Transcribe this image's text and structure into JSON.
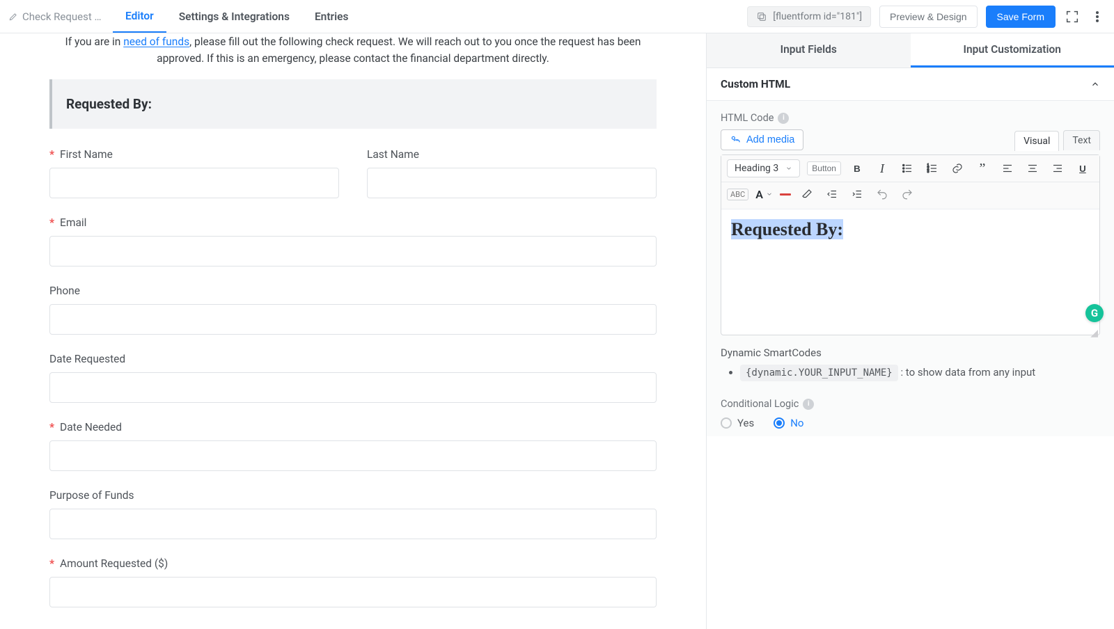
{
  "topbar": {
    "doc_title": "Check Request F...",
    "tabs": [
      {
        "label": "Editor",
        "active": true
      },
      {
        "label": "Settings & Integrations",
        "active": false
      },
      {
        "label": "Entries",
        "active": false
      }
    ],
    "shortcode": "[fluentform id=\"181\"]",
    "preview": "Preview & Design",
    "save": "Save Form"
  },
  "form": {
    "intro_prefix": "If you are in ",
    "intro_link": "need of funds",
    "intro_rest": ", please fill out the following check request. We will reach out to you once the request has been approved. If this is an emergency, please contact the financial department directly.",
    "section_title": "Requested By:",
    "fields": {
      "first_name": "First Name",
      "last_name": "Last Name",
      "email": "Email",
      "phone": "Phone",
      "date_requested": "Date Requested",
      "date_needed": "Date Needed",
      "purpose": "Purpose of Funds",
      "amount": "Amount Requested ($)"
    }
  },
  "inspector": {
    "tabs": {
      "input_fields": "Input Fields",
      "input_custom": "Input Customization"
    },
    "panel_title": "Custom HTML",
    "html_code_label": "HTML Code",
    "add_media": "Add media",
    "mode_visual": "Visual",
    "mode_text": "Text",
    "format_dd": "Heading 3",
    "tag_btn": "Button",
    "rte_sel_text": "Requested By:",
    "smartcodes_label": "Dynamic SmartCodes",
    "smartcode_chip": "{dynamic.YOUR_INPUT_NAME}",
    "smartcode_desc": ": to show data from any input",
    "cond_label": "Conditional Logic",
    "yes": "Yes",
    "no": "No"
  }
}
